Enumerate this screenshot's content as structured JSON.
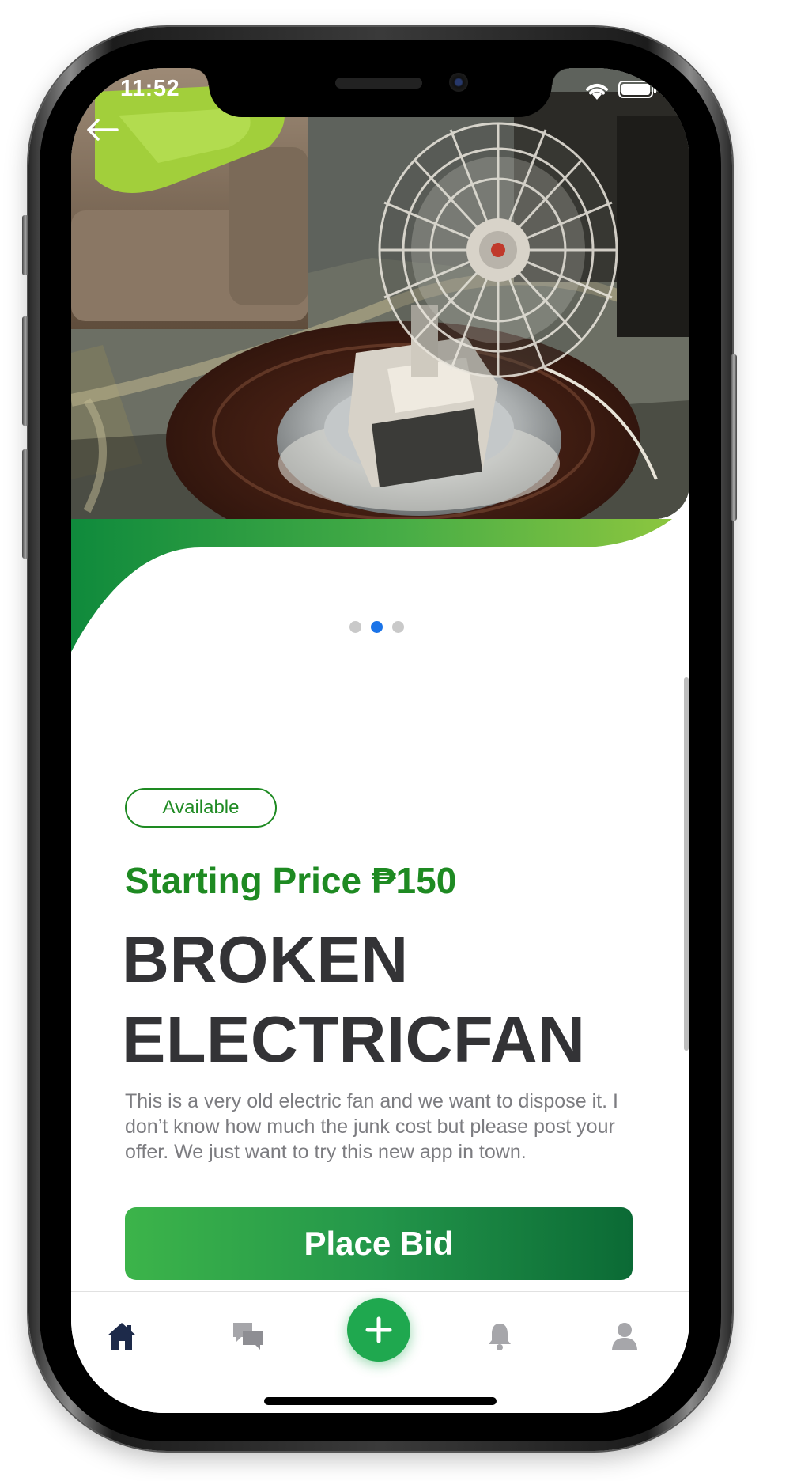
{
  "status_bar": {
    "time": "11:52",
    "icons": [
      "wifi-icon",
      "battery-icon"
    ]
  },
  "header": {
    "back_icon": "arrow-left-icon"
  },
  "carousel": {
    "image_subject": "electric fan photo",
    "page_count": 3,
    "active_index": 1,
    "colors": {
      "dot_active": "#1a73e8",
      "dot_inactive": "#c9c9c9"
    }
  },
  "listing": {
    "status_label": "Available",
    "price_label": "Starting Price ₱150",
    "title": "BROKEN ELECTRICFAN",
    "description": "This is a very old electric fan and we want to dispose it. I don’t know how much the junk cost but please post your offer. We just want to try this new app in town.",
    "bid_button_label": "Place Bid"
  },
  "tab_bar": {
    "items": [
      {
        "icon": "home-icon",
        "active": true
      },
      {
        "icon": "chat-icon",
        "active": false
      },
      {
        "icon": "plus-icon",
        "active": false
      },
      {
        "icon": "bell-icon",
        "active": false
      },
      {
        "icon": "user-icon",
        "active": false
      }
    ]
  },
  "colors": {
    "accent_green": "#1e8a22",
    "button_gradient_start": "#3cb44a",
    "button_gradient_end": "#0b6a35",
    "title_text": "#333336",
    "body_text": "#7c7c80",
    "tab_active": "#1d2a4a",
    "tab_inactive": "#a6a6aa"
  }
}
